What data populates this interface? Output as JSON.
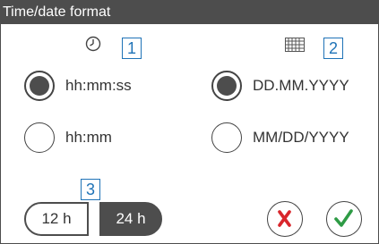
{
  "window": {
    "title": "Time/date format"
  },
  "time_format": {
    "callout": "1",
    "icon": "clock-icon",
    "options": [
      {
        "label": "hh:mm:ss",
        "selected": true
      },
      {
        "label": "hh:mm",
        "selected": false
      }
    ]
  },
  "date_format": {
    "callout": "2",
    "icon": "calendar-icon",
    "options": [
      {
        "label": "DD.MM.YYYY",
        "selected": true
      },
      {
        "label": "MM/DD/YYYY",
        "selected": false
      }
    ]
  },
  "hour_mode": {
    "callout": "3",
    "options": [
      {
        "label": "12 h",
        "selected": false
      },
      {
        "label": "24 h",
        "selected": true
      }
    ]
  },
  "actions": {
    "cancel_icon": "cross-icon",
    "confirm_icon": "check-icon",
    "cancel_color": "#d9262c",
    "confirm_color": "#2e9b45"
  }
}
